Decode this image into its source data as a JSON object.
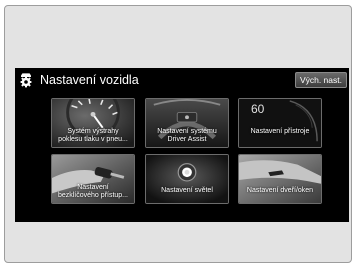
{
  "header": {
    "title": "Nastavení vozidla",
    "default_button": "Vých. nast.",
    "icon": "settings-car-icon"
  },
  "tiles": [
    {
      "label_lines": [
        "Systém výstrahy",
        "poklesu tlaku v pneu..."
      ],
      "icon": "tire-gauge-icon"
    },
    {
      "label_lines": [
        "Nastavení systému",
        "Driver Assist"
      ],
      "icon": "steering-wheel-icon"
    },
    {
      "label_lines": [
        "Nastavení přístroje"
      ],
      "display_value": "60",
      "icon": "speedometer-icon"
    },
    {
      "label_lines": [
        "Nastavení",
        "bezklíčového přístup..."
      ],
      "icon": "key-fob-icon"
    },
    {
      "label_lines": [
        "Nastavení světel"
      ],
      "icon": "headlight-icon"
    },
    {
      "label_lines": [
        "Nastavení dveří/oken"
      ],
      "icon": "car-door-icon"
    }
  ],
  "colors": {
    "screen_bg": "#000000",
    "frame_bg": "#e3e3e3",
    "text": "#ffffff"
  }
}
